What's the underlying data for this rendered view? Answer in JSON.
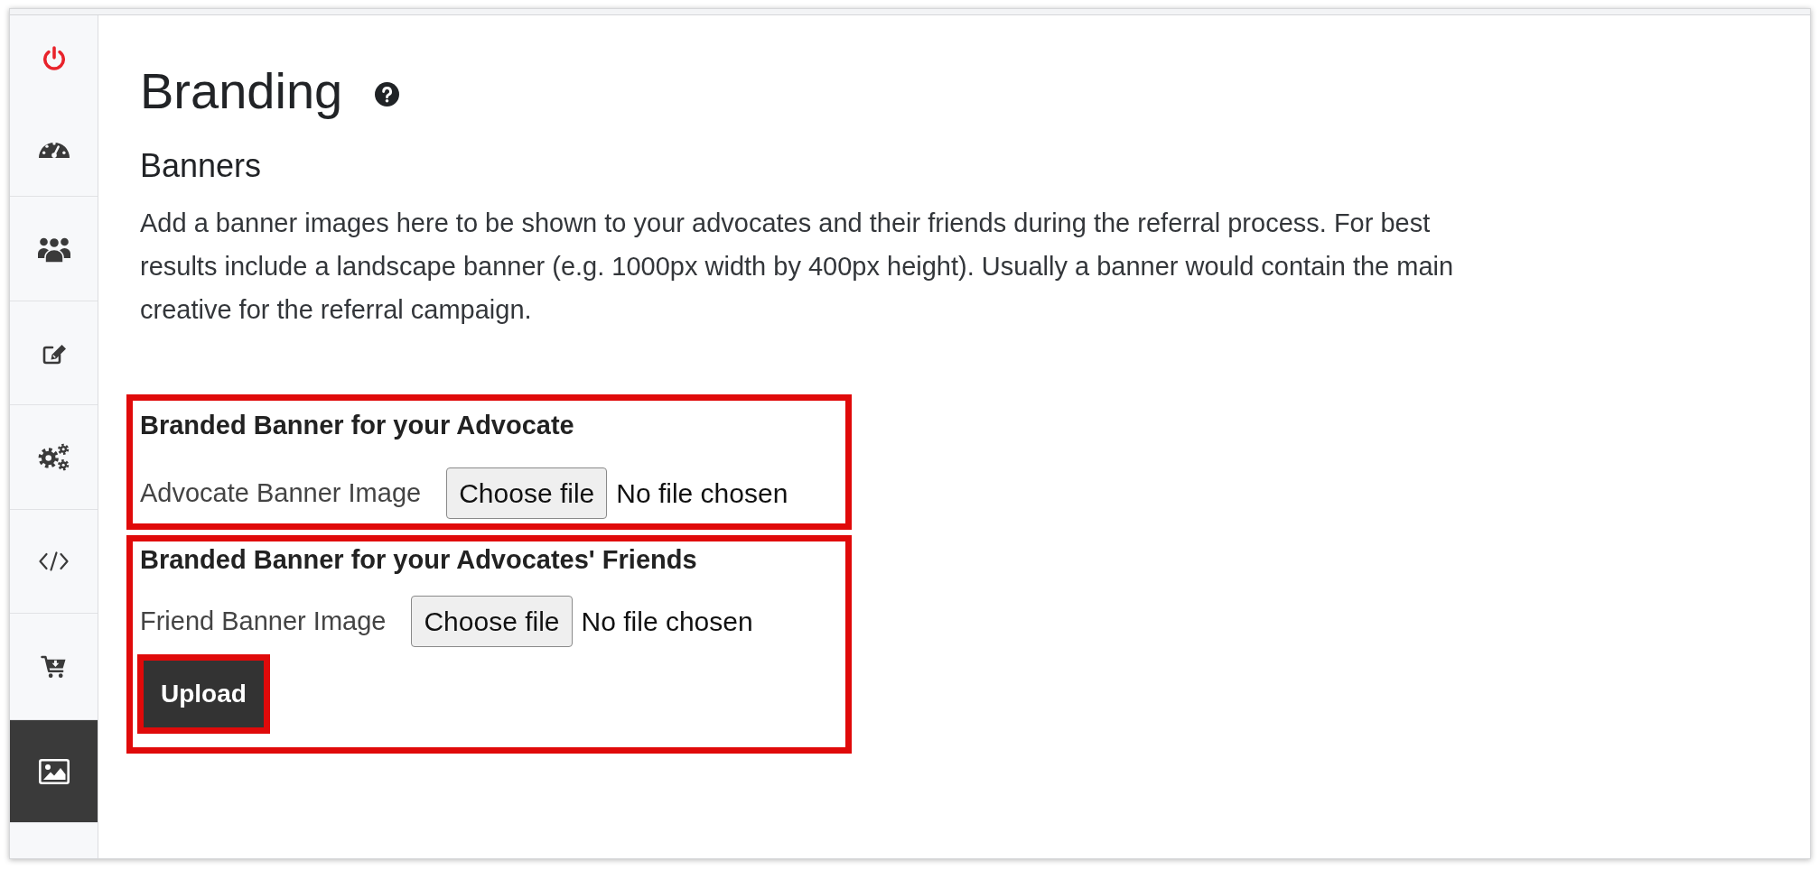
{
  "sidebar": {
    "items": [
      {
        "selected": false
      },
      {
        "selected": false
      },
      {
        "selected": false
      },
      {
        "selected": false
      },
      {
        "selected": false
      },
      {
        "selected": false
      },
      {
        "selected": false
      },
      {
        "selected": true
      }
    ]
  },
  "page": {
    "title": "Branding"
  },
  "section": {
    "title": "Banners",
    "description": "Add a banner images here to be shown to your advocates and their friends during the referral process. For best results include a landscape banner (e.g. 1000px width by 400px height). Usually a banner would contain the main creative for the referral campaign."
  },
  "upload_form": {
    "groups": [
      {
        "title": "Branded Banner for your Advocate",
        "highlighted": true,
        "field_label": "Advocate Banner Image",
        "button": "Choose file",
        "status": "No file chosen"
      },
      {
        "title": "Branded Banner for your Advocates' Friends",
        "highlighted": true,
        "field_label": "Friend Banner Image",
        "button": "Choose file",
        "status": "No file chosen"
      }
    ],
    "submit_button": {
      "label": "Upload",
      "highlighted": true
    }
  }
}
